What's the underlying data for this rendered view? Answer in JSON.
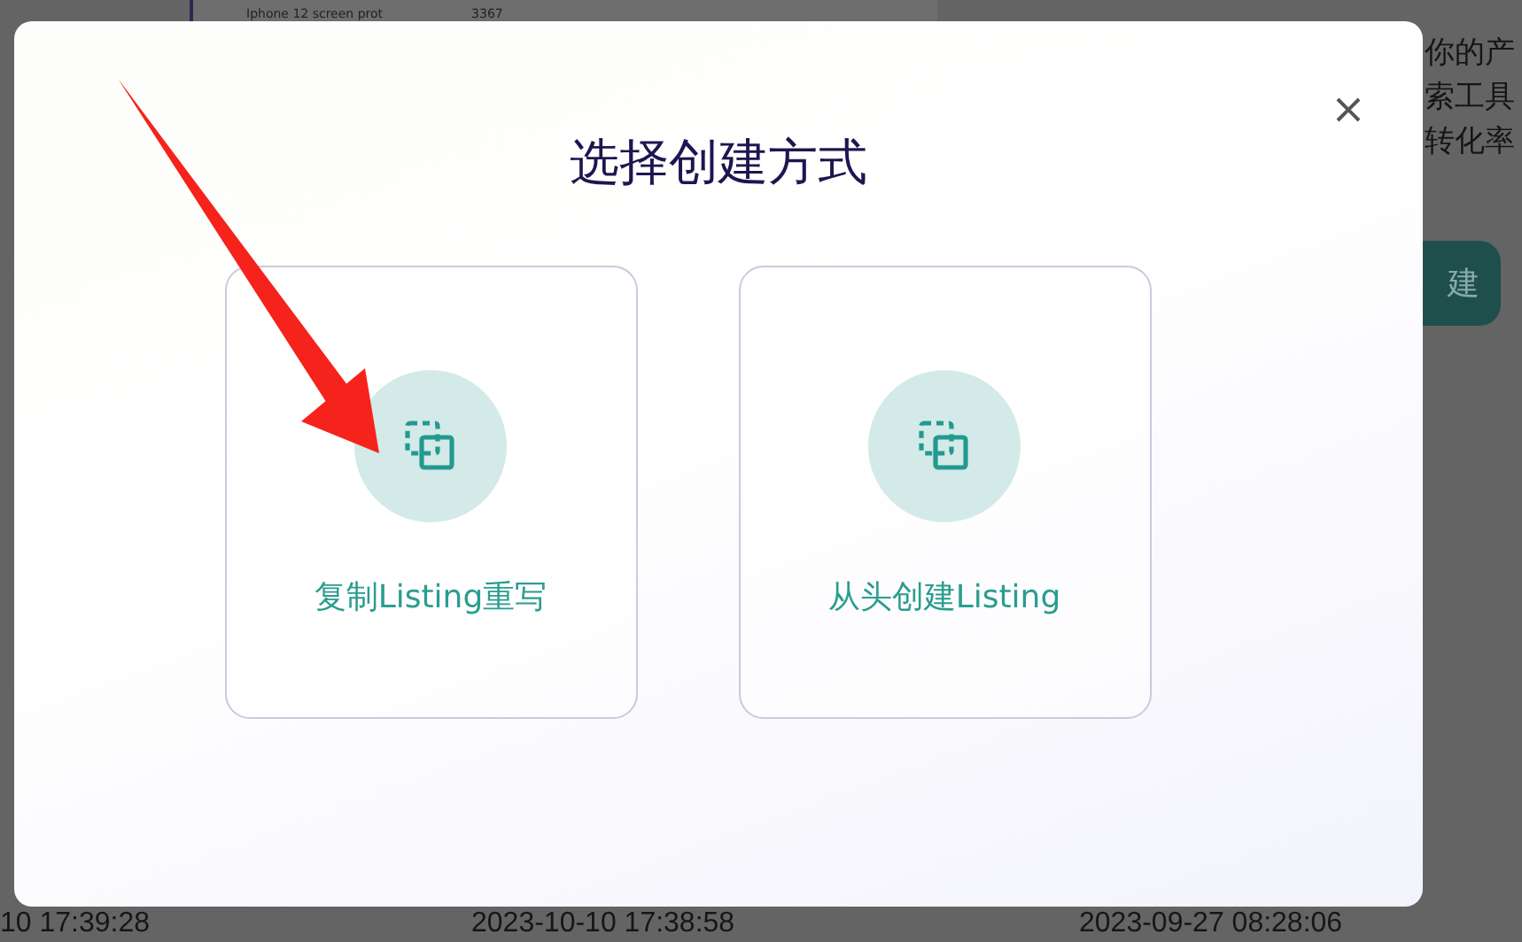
{
  "background": {
    "table_row": [
      "Iphone 12 screen prot",
      "3367"
    ],
    "side_lines": [
      "你的产",
      "索工具",
      "转化率"
    ],
    "button": "建",
    "timestamps": [
      "10 17:39:28",
      "2023-10-10 17:38:58",
      "2023-09-27 08:28:06"
    ]
  },
  "dialog": {
    "title": "选择创建方式",
    "options": [
      {
        "label": "复制Listing重写"
      },
      {
        "label": "从头创建Listing"
      }
    ]
  }
}
